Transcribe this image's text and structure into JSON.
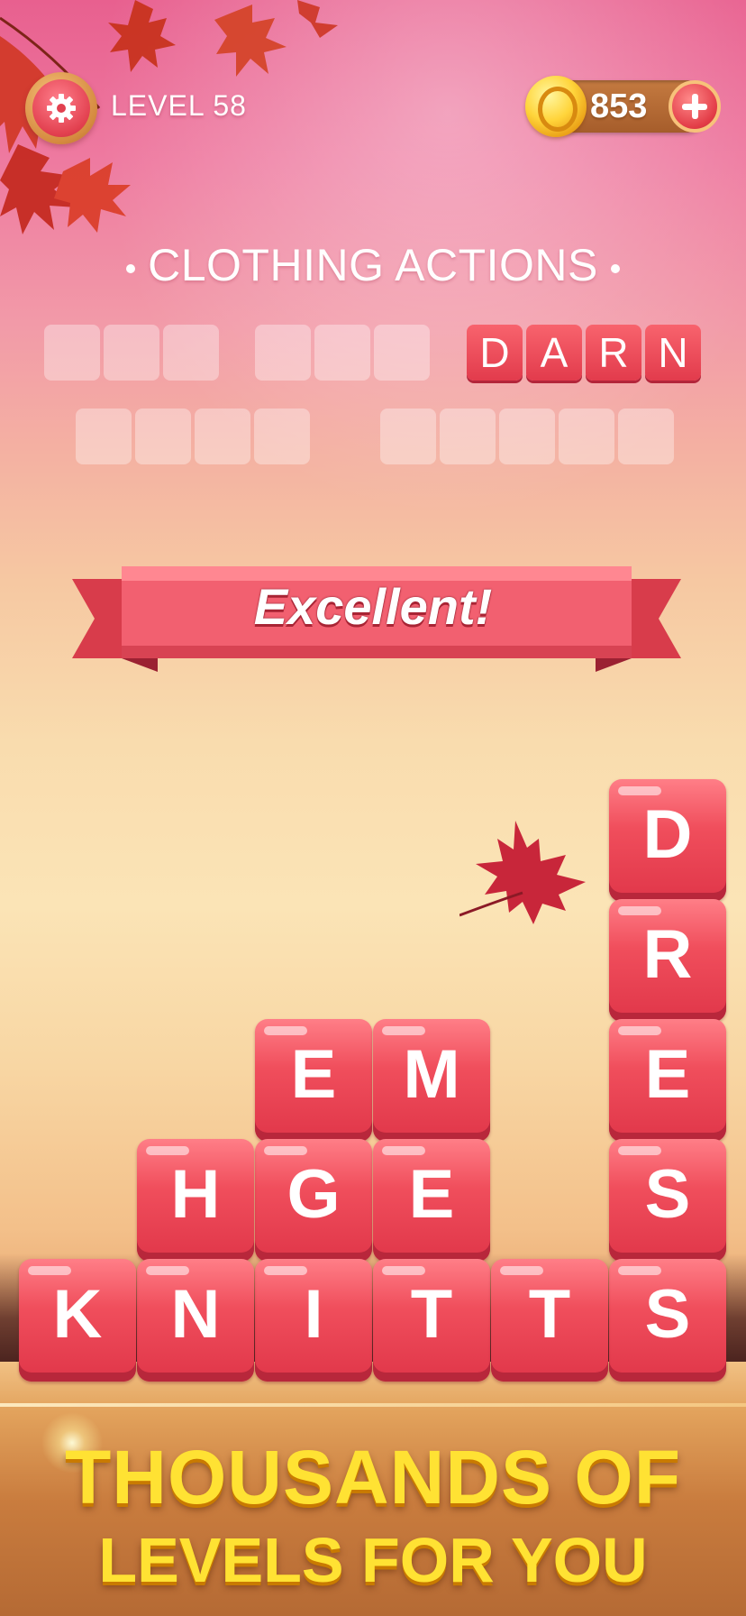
{
  "header": {
    "level_label": "LEVEL 58",
    "coins": "853"
  },
  "category": "CLOTHING ACTIONS",
  "answers": {
    "row1": [
      {
        "letters": [
          "",
          "",
          ""
        ],
        "solved": false
      },
      {
        "letters": [
          "",
          "",
          ""
        ],
        "solved": false
      },
      {
        "letters": [
          "D",
          "A",
          "R",
          "N"
        ],
        "solved": true
      }
    ],
    "row2": [
      {
        "letters": [
          "",
          "",
          "",
          ""
        ],
        "solved": false
      },
      {
        "letters": [
          "",
          "",
          "",
          "",
          ""
        ],
        "solved": false
      }
    ],
    "darn": [
      "D",
      "A",
      "R",
      "N"
    ]
  },
  "banner_text": "Excellent!",
  "board": {
    "col1": [
      "K"
    ],
    "col2": [
      "H",
      "N"
    ],
    "col3": [
      "E",
      "G",
      "I"
    ],
    "col4": [
      "M",
      "E",
      "T"
    ],
    "col5": [
      "T"
    ],
    "col6": [
      "D",
      "R",
      "E",
      "S",
      "S"
    ]
  },
  "promo": {
    "line1": "THOUSANDS OF",
    "line2": "LEVELS FOR YOU"
  },
  "colors": {
    "tile": "#f04e5c",
    "promo_text": "#ffe233",
    "coin": "#ffd43a"
  },
  "icons": [
    "gear-icon",
    "coin-icon",
    "plus-icon",
    "maple-leaf-icon"
  ]
}
